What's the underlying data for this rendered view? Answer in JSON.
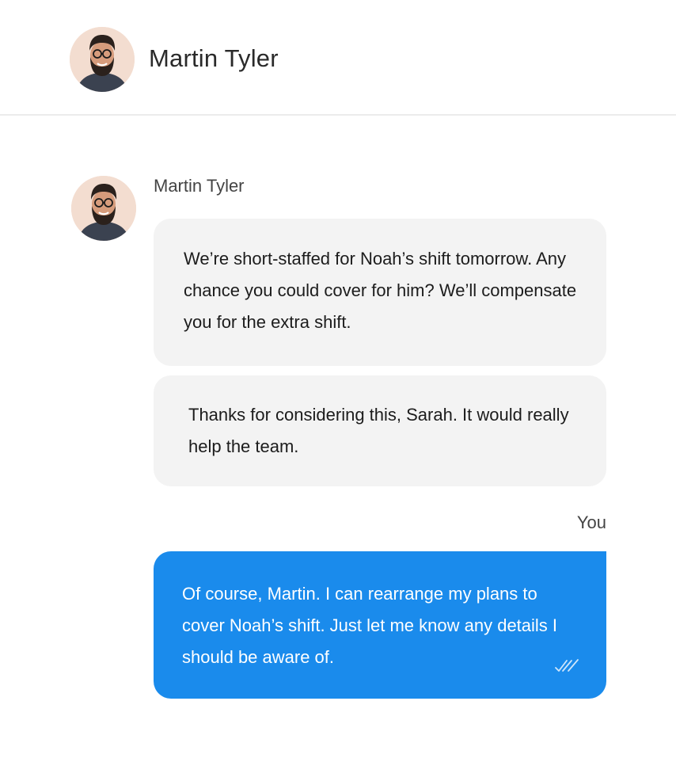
{
  "contact": {
    "name": "Martin Tyler"
  },
  "thread": {
    "incoming_sender": "Martin Tyler",
    "messages": [
      {
        "from": "Martin Tyler",
        "text": "We’re short-staffed for Noah’s shift tomorrow. Any chance you could cover for him? We’ll compensate you for the extra shift."
      },
      {
        "from": "Martin Tyler",
        "text": "Thanks for considering this, Sarah. It would really help the team."
      },
      {
        "from": "You",
        "text": "Of course, Martin. I can rearrange my plans to cover Noah’s shift. Just let me know any details I should be aware of.",
        "status_icon": "double-check-read-icon"
      }
    ],
    "outgoing_label": "You"
  },
  "colors": {
    "outgoing_bubble": "#1a8bec",
    "incoming_bubble": "#f3f3f3",
    "divider": "#ececec"
  }
}
